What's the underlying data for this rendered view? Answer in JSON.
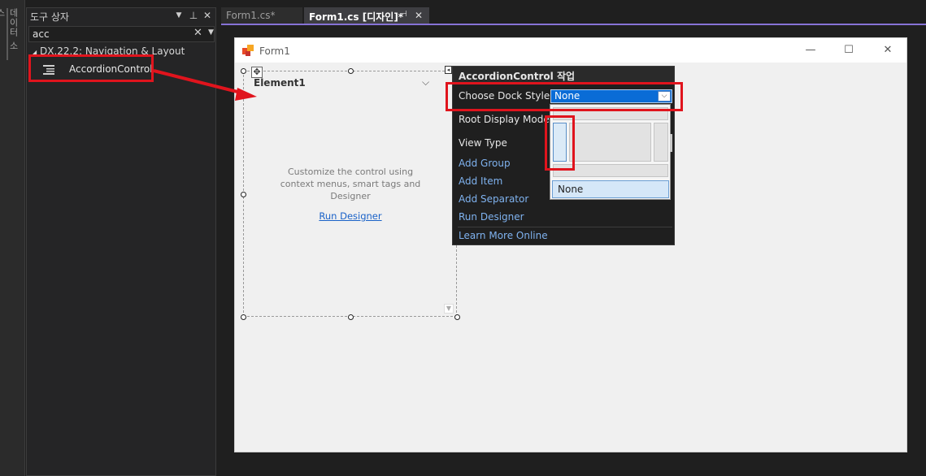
{
  "side_panel": {
    "tab_label": "데이터 소스"
  },
  "toolbox": {
    "title": "도구 상자",
    "search_value": "acc",
    "group_label": "DX.22.2: Navigation & Layout",
    "item_label": "AccordionControl"
  },
  "tabs": [
    {
      "label": "Form1.cs*"
    },
    {
      "label": "Form1.cs [디자인]*"
    }
  ],
  "form": {
    "caption": "Form1",
    "accordion": {
      "element_label": "Element1",
      "hint": "Customize the control using context menus, smart tags and Designer",
      "run_designer_link": "Run Designer"
    }
  },
  "tasks": {
    "title": "AccordionControl 작업",
    "choose_dock_style": "Choose Dock Style",
    "dock_value": "None",
    "root_display_mode": "Root Display Mode",
    "view_type": "View Type",
    "add_group": "Add Group",
    "add_item": "Add Item",
    "add_separator": "Add Separator",
    "run_designer": "Run Designer",
    "learn_more": "Learn More Online"
  },
  "dock_picker": {
    "none_option": "None"
  },
  "colors": {
    "accent": "#8672d6",
    "annotation_red": "#e0141d",
    "link_blue": "#1a62c8"
  }
}
